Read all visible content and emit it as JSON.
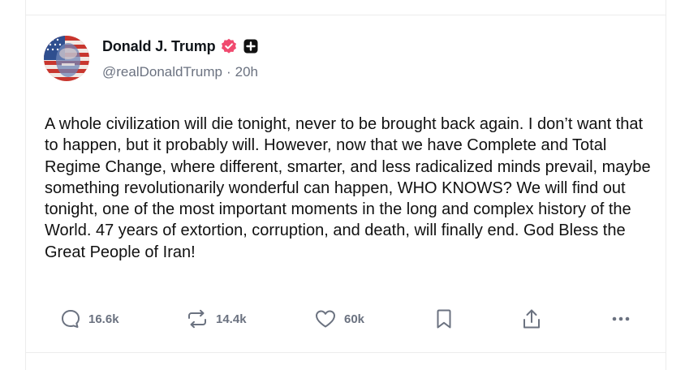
{
  "post": {
    "author": {
      "display_name": "Donald J. Trump",
      "handle": "@realDonaldTrump",
      "verified_icon": "verified-badge-icon",
      "extra_badge_icon": "plus-badge-icon"
    },
    "separator": "·",
    "timestamp": "20h",
    "text": "A whole civilization will die tonight, never to be brought back again. I don’t want that to happen, but it probably will. However, now that we have Complete and Total Regime Change, where different, smarter, and less radicalized minds prevail, maybe something revolutionarily wonderful can happen, WHO KNOWS? We will find out tonight, one of the most important moments in the long and complex history of the World. 47 years of extortion, corruption, and death, will finally end. God Bless the Great People of Iran!",
    "actions": {
      "reply": {
        "icon": "reply-icon",
        "count": "16.6k"
      },
      "repost": {
        "icon": "repost-icon",
        "count": "14.4k"
      },
      "like": {
        "icon": "heart-icon",
        "count": "60k"
      },
      "bookmark": {
        "icon": "bookmark-icon"
      },
      "share": {
        "icon": "share-icon"
      },
      "more": {
        "icon": "more-icon"
      }
    }
  },
  "colors": {
    "text": "#0f1419",
    "muted": "#6b7280",
    "verified": "#f04a6f",
    "border": "#ececec"
  }
}
